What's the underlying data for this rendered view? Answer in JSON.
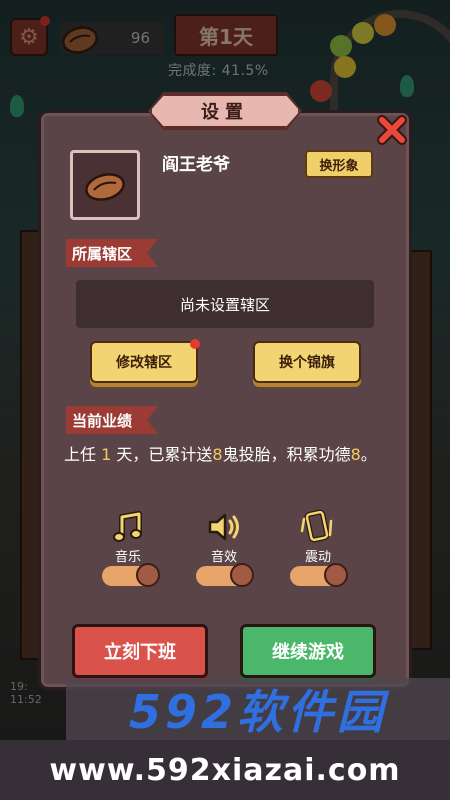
{
  "hud": {
    "coins": "96",
    "day_label": "第1天",
    "progress_label": "完成度: 41.5%"
  },
  "panel": {
    "title": "设置",
    "player_name": "阎王老爷",
    "change_skin_label": "换形象",
    "district_tag": "所属辖区",
    "district_value": "尚未设置辖区",
    "edit_district_label": "修改辖区",
    "change_flag_label": "换个锦旗",
    "performance_tag": "当前业绩",
    "performance": {
      "part1": "上任 ",
      "days": "1",
      "part2": " 天，已累计送",
      "ghosts": "8",
      "part3": "鬼投胎，积累功德",
      "merit": "8",
      "part4": "。"
    },
    "settings": [
      {
        "label": "音乐",
        "icon": "music-note-icon",
        "enabled": true
      },
      {
        "label": "音效",
        "icon": "speaker-icon",
        "enabled": true
      },
      {
        "label": "震动",
        "icon": "vibrate-phone-icon",
        "enabled": true
      }
    ],
    "quit_label": "立刻下班",
    "continue_label": "继续游戏"
  },
  "background": {
    "clock_text_1": "19:",
    "clock_text_2": "11:52"
  },
  "watermark": {
    "logo": "592软件园",
    "url": "www.592xiazai.com"
  },
  "colors": {
    "panel_bg": "#5b4447",
    "tag_red": "#9b3b33",
    "button_yellow": "#f2d472",
    "button_red": "#d9534b",
    "button_green": "#4ab76a",
    "highlight": "#f2cd5d",
    "notification_dot": "#e53b2f"
  }
}
